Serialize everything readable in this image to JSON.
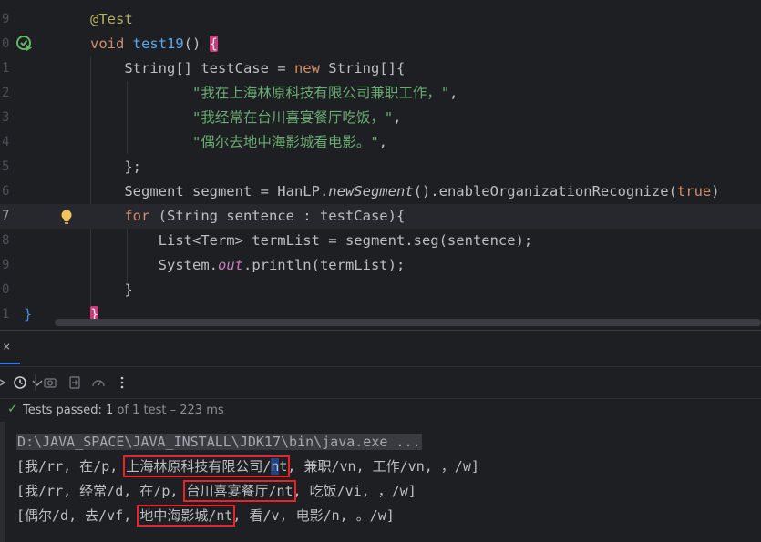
{
  "editor": {
    "lines": [
      {
        "num": "9",
        "tokens": [
          {
            "t": "@Test",
            "c": "ann"
          }
        ]
      },
      {
        "num": "0",
        "tokens": [
          {
            "t": "void ",
            "c": "kw"
          },
          {
            "t": "test19",
            "c": "fn"
          },
          {
            "t": "() ",
            "c": ""
          },
          {
            "t": "{",
            "c": "brace-hl"
          }
        ]
      },
      {
        "num": "1",
        "tokens": [
          {
            "t": "    String[] testCase = ",
            "c": ""
          },
          {
            "t": "new ",
            "c": "kw"
          },
          {
            "t": "String[]{",
            "c": ""
          }
        ]
      },
      {
        "num": "2",
        "tokens": [
          {
            "t": "            ",
            "c": ""
          },
          {
            "t": "\"我在上海林原科技有限公司兼职工作，\"",
            "c": "str"
          },
          {
            "t": ",",
            "c": ""
          }
        ]
      },
      {
        "num": "3",
        "tokens": [
          {
            "t": "            ",
            "c": ""
          },
          {
            "t": "\"我经常在台川喜宴餐厅吃饭，\"",
            "c": "str"
          },
          {
            "t": ",",
            "c": ""
          }
        ]
      },
      {
        "num": "4",
        "tokens": [
          {
            "t": "            ",
            "c": ""
          },
          {
            "t": "\"偶尔去地中海影城看电影。\"",
            "c": "str"
          },
          {
            "t": ",",
            "c": ""
          }
        ]
      },
      {
        "num": "5",
        "tokens": [
          {
            "t": "    };",
            "c": ""
          }
        ]
      },
      {
        "num": "6",
        "tokens": [
          {
            "t": "    Segment segment = HanLP.",
            "c": ""
          },
          {
            "t": "newSegment",
            "c": "ital"
          },
          {
            "t": "().enableOrganizationRecognize(",
            "c": ""
          },
          {
            "t": "true",
            "c": "kw"
          },
          {
            "t": ")",
            "c": ""
          }
        ]
      },
      {
        "num": "7",
        "tokens": [
          {
            "t": "    ",
            "c": ""
          },
          {
            "t": "for ",
            "c": "kw"
          },
          {
            "t": "(String sentence : testCase){",
            "c": ""
          }
        ]
      },
      {
        "num": "8",
        "tokens": [
          {
            "t": "        List<Term> termList = segment.seg(sentence);",
            "c": ""
          }
        ]
      },
      {
        "num": "9",
        "tokens": [
          {
            "t": "        System.",
            "c": ""
          },
          {
            "t": "out",
            "c": "static"
          },
          {
            "t": ".println(termList);",
            "c": ""
          }
        ]
      },
      {
        "num": "0",
        "tokens": [
          {
            "t": "    }",
            "c": ""
          }
        ]
      },
      {
        "num": "1",
        "tokens": [
          {
            "t": "}",
            "c": "brace-hl"
          }
        ]
      }
    ],
    "outer_brace": "}"
  },
  "panel": {
    "close_glyph": "×",
    "status": {
      "label": "Tests passed: ",
      "count": "1",
      "rest": " of 1 test – 223 ms"
    },
    "console": {
      "command": "D:\\JAVA_SPACE\\JAVA_INSTALL\\JDK17\\bin\\java.exe ...",
      "out1": {
        "pre": "[我/rr, 在/p, ",
        "boxed_a": "上海林原科技有限公司/",
        "caret": "n",
        "boxed_b": "t",
        "post": ", 兼职/vn, 工作/vn, ，/w]"
      },
      "out2": {
        "pre": "[我/rr, 经常/d, 在/p, ",
        "boxed": "台川喜宴餐厅/nt",
        "post": ", 吃饭/vi, ，/w]"
      },
      "out3": {
        "pre": "[偶尔/d, 去/vf, ",
        "boxed": "地中海影城/nt",
        "post": ", 看/v, 电影/n, 。/w]"
      }
    }
  }
}
